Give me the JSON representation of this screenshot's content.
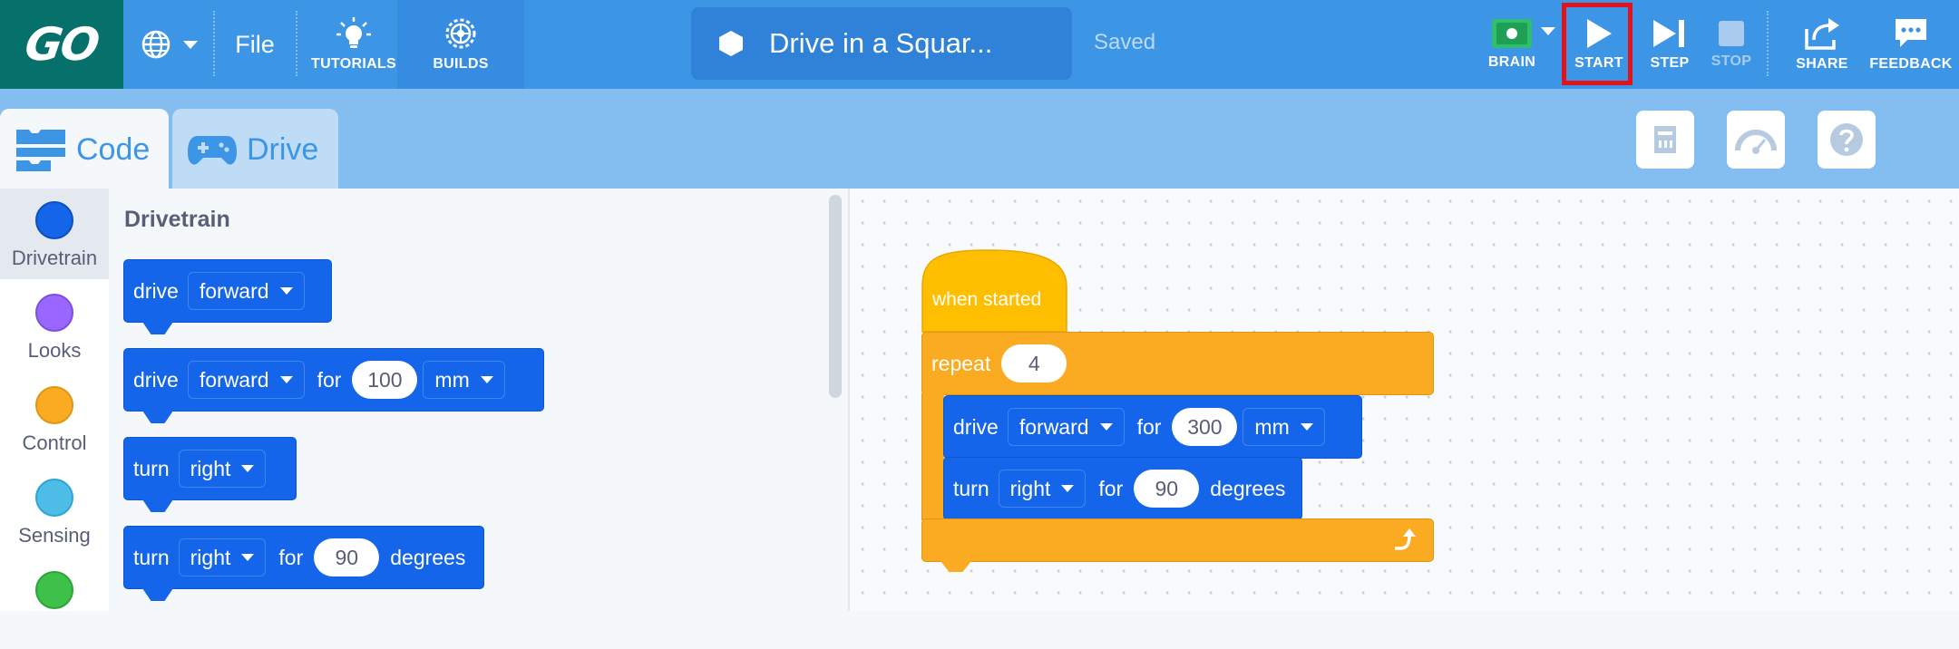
{
  "app": {
    "logo_text": "GO",
    "file_label": "File",
    "tutorials_label": "TUTORIALS",
    "builds_label": "BUILDS",
    "project_name": "Drive in a Squar...",
    "saved_status": "Saved",
    "brain_label": "BRAIN",
    "start_label": "START",
    "step_label": "STEP",
    "stop_label": "STOP",
    "share_label": "SHARE",
    "feedback_label": "FEEDBACK"
  },
  "tabs": [
    {
      "label": "Code",
      "icon": "code-blocks-icon",
      "active": true
    },
    {
      "label": "Drive",
      "icon": "gamepad-icon",
      "active": false
    }
  ],
  "toolbar_icons": [
    "device-port-icon",
    "dashboard-gauge-icon",
    "help-icon"
  ],
  "categories": [
    {
      "label": "Drivetrain",
      "color": "#1565ea",
      "selected": true
    },
    {
      "label": "Looks",
      "color": "#9966ff"
    },
    {
      "label": "Control",
      "color": "#fbab22"
    },
    {
      "label": "Sensing",
      "color": "#4dbde8"
    },
    {
      "label": "",
      "color": "#3ec14a"
    }
  ],
  "palette": {
    "title": "Drivetrain",
    "blocks": [
      {
        "verb": "drive",
        "dir": "forward"
      },
      {
        "verb": "drive",
        "dir": "forward",
        "for": "for",
        "value": "100",
        "unit": "mm"
      },
      {
        "verb": "turn",
        "dir": "right"
      },
      {
        "verb": "turn",
        "dir": "right",
        "for": "for",
        "value": "90",
        "unit": "degrees"
      }
    ]
  },
  "script": {
    "hat": "when started",
    "repeat_label": "repeat",
    "repeat_count": "4",
    "drive": {
      "verb": "drive",
      "dir": "forward",
      "for": "for",
      "value": "300",
      "unit": "mm"
    },
    "turn": {
      "verb": "turn",
      "dir": "right",
      "for": "for",
      "value": "90",
      "unit": "degrees"
    }
  },
  "colors": {
    "topbar": "#3d95e6",
    "logo_bg": "#06716a",
    "tabbar": "#84bdef",
    "drivetrain_block": "#1565ea",
    "control_block": "#fbab22",
    "hat_block": "#ffbf00",
    "start_highlight": "#e1141b"
  }
}
